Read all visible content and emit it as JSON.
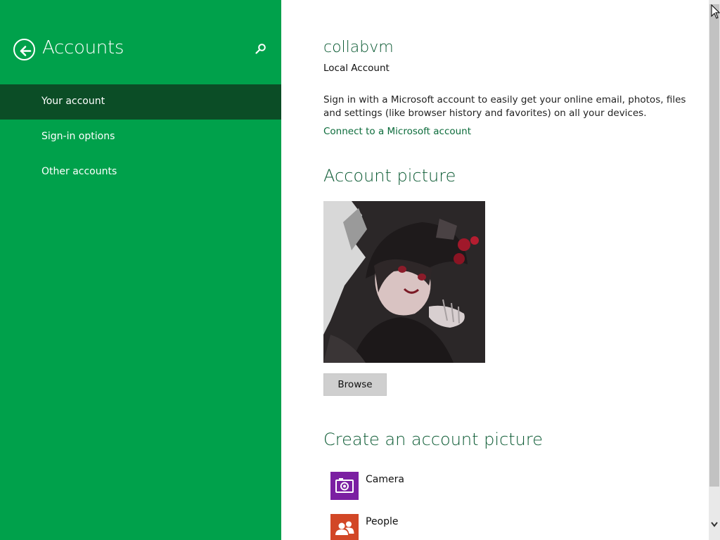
{
  "window": {
    "title": "Accounts"
  },
  "sidebar": {
    "items": [
      {
        "label": "Your account",
        "selected": true
      },
      {
        "label": "Sign-in options",
        "selected": false
      },
      {
        "label": "Other accounts",
        "selected": false
      }
    ]
  },
  "account": {
    "username": "collabvm",
    "type": "Local Account",
    "description": "Sign in with a Microsoft account to easily get your online email, photos, files and settings (like browser history and favorites) on all your devices.",
    "connect_link": "Connect to a Microsoft account"
  },
  "picture_section": {
    "heading": "Account picture",
    "browse_label": "Browse"
  },
  "create_section": {
    "heading": "Create an account picture",
    "apps": [
      {
        "label": "Camera",
        "icon": "camera-icon",
        "color": "#7b1fa2"
      },
      {
        "label": "People",
        "icon": "people-icon",
        "color": "#d24726"
      }
    ]
  },
  "colors": {
    "accent": "#00a14b",
    "selected": "#0b4d26",
    "heading": "#0b5a33",
    "link": "#0b6b3a"
  },
  "icons": [
    "back-arrow-icon",
    "search-icon",
    "camera-icon",
    "people-icon",
    "scroll-down-icon",
    "mouse-cursor-icon"
  ]
}
